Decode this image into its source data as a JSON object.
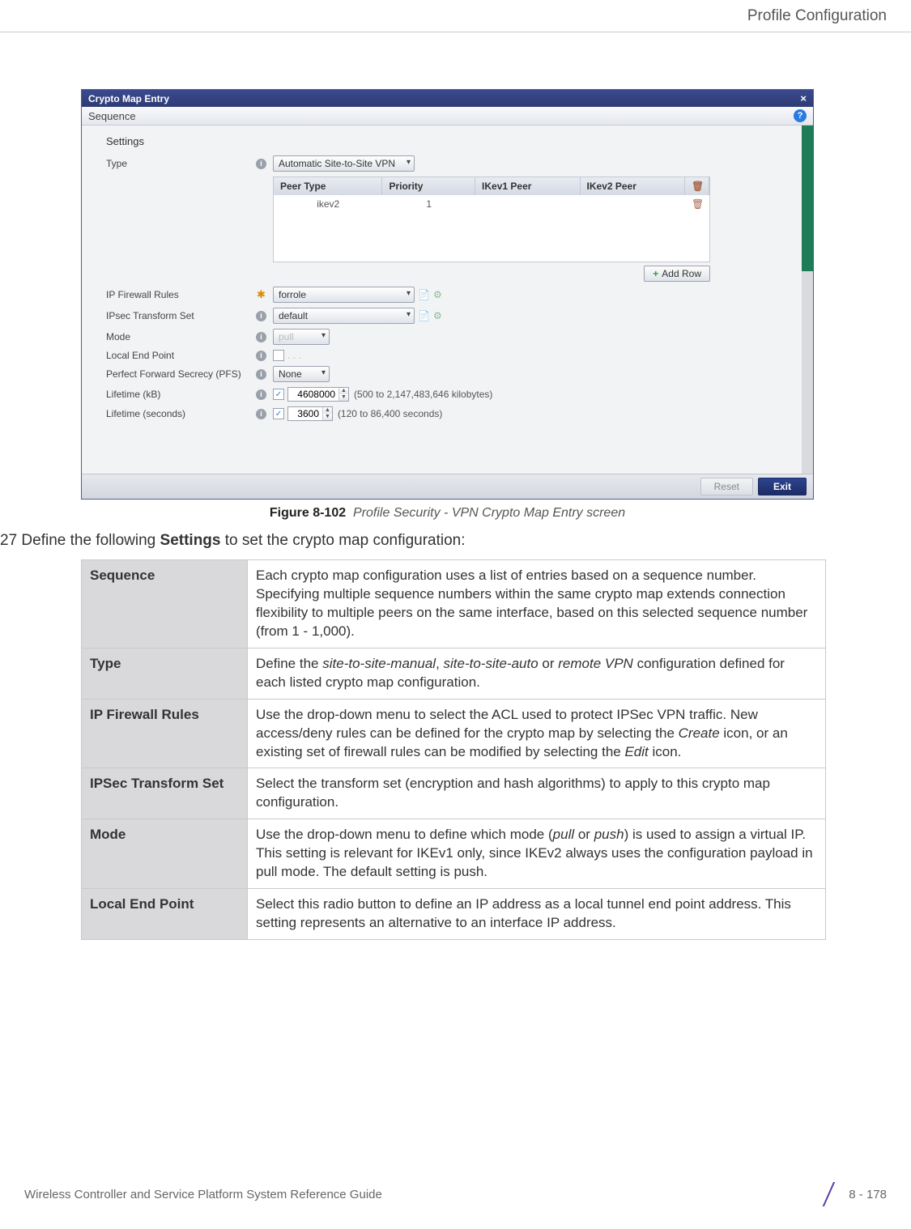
{
  "header": {
    "title": "Profile Configuration"
  },
  "dlg": {
    "title": "Crypto Map Entry",
    "subtitle": "Sequence",
    "settings": {
      "fieldset": "Settings",
      "type_label": "Type",
      "type_value": "Automatic Site-to-Site VPN",
      "peer_table": {
        "headers": {
          "c1": "Peer Type",
          "c2": "Priority",
          "c3": "IKev1 Peer",
          "c4": "IKev2 Peer"
        },
        "row": {
          "peer_type": "ikev2",
          "priority": "1",
          "ikev1": "",
          "ikev2": ""
        }
      },
      "add_row": "Add Row",
      "ip_fw_label": "IP Firewall Rules",
      "ip_fw_value": "forrole",
      "ipsec_ts_label": "IPsec Transform Set",
      "ipsec_ts_value": "default",
      "mode_label": "Mode",
      "mode_value": "pull",
      "lep_label": "Local End Point",
      "pfs_label": "Perfect Forward Secrecy (PFS)",
      "pfs_value": "None",
      "lt_kb_label": "Lifetime (kB)",
      "lt_kb_value": "4608000",
      "lt_kb_hint": "(500 to 2,147,483,646 kilobytes)",
      "lt_sec_label": "Lifetime (seconds)",
      "lt_sec_value": "3600",
      "lt_sec_hint": "(120 to 86,400 seconds)"
    },
    "footer": {
      "reset": "Reset",
      "exit": "Exit"
    }
  },
  "fig": {
    "num": "Figure 8-102",
    "caption": "Profile Security - VPN Crypto Map Entry screen"
  },
  "para_prefix": "27 Define the following ",
  "para_bold": "Settings",
  "para_suffix": " to set the crypto map configuration:",
  "tbl": {
    "r1h": "Sequence",
    "r1": "Each crypto map configuration uses a list of entries based on a sequence number. Specifying multiple sequence numbers within the same crypto map extends connection flexibility to multiple peers on the same interface, based on this selected sequence number (from 1 - 1,000).",
    "r2h": "Type",
    "r2a": "Define the ",
    "r2i1": "site-to-site-manual",
    "r2b": ", ",
    "r2i2": "site-to-site-auto",
    "r2c": " or ",
    "r2i3": "remote VPN",
    "r2d": " configuration defined for each listed crypto map configuration.",
    "r3h": "IP Firewall Rules",
    "r3a": "Use the drop-down menu to select the ACL used to protect IPSec VPN traffic. New access/deny rules can be defined for the crypto map by selecting the ",
    "r3i1": "Create",
    "r3b": " icon, or an existing set of firewall rules can be modified by selecting the ",
    "r3i2": "Edit",
    "r3c": " icon.",
    "r4h": "IPSec Transform Set",
    "r4": "Select the transform set (encryption and hash algorithms) to apply to this crypto map configuration.",
    "r5h": "Mode",
    "r5a": "Use the drop-down menu to define which mode (",
    "r5i1": "pull",
    "r5b": " or ",
    "r5i2": "push",
    "r5c": ") is used to assign a virtual IP. This setting is relevant for IKEv1 only, since IKEv2 always uses the configuration payload in pull mode. The default setting is push.",
    "r6h": "Local End Point",
    "r6": "Select this radio button to define an IP address as a local tunnel end point address. This setting represents an alternative to an interface IP address."
  },
  "footer": {
    "left": "Wireless Controller and Service Platform System Reference Guide",
    "page": "8 - 178"
  }
}
